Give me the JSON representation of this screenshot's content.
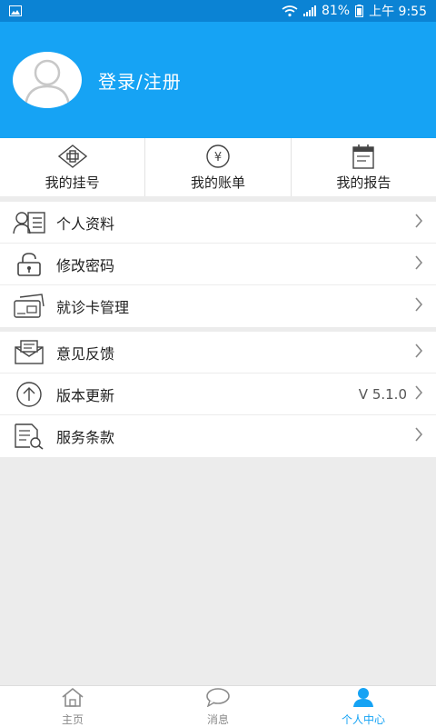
{
  "status_bar": {
    "battery": "81%",
    "time": "上午 9:55"
  },
  "header": {
    "login_text": "登录/注册"
  },
  "quick_actions": [
    {
      "label": "我的挂号",
      "icon": "registration-icon"
    },
    {
      "label": "我的账单",
      "icon": "bill-icon"
    },
    {
      "label": "我的报告",
      "icon": "report-icon"
    }
  ],
  "menu_group_1": [
    {
      "label": "个人资料",
      "icon": "profile-card-icon"
    },
    {
      "label": "修改密码",
      "icon": "lock-icon"
    },
    {
      "label": "就诊卡管理",
      "icon": "card-icon"
    }
  ],
  "menu_group_2": [
    {
      "label": "意见反馈",
      "icon": "feedback-mail-icon"
    },
    {
      "label": "版本更新",
      "icon": "update-arrow-icon",
      "value": "V 5.1.0"
    },
    {
      "label": "服务条款",
      "icon": "terms-document-icon"
    }
  ],
  "tabs": [
    {
      "label": "主页",
      "icon": "home-icon",
      "active": false
    },
    {
      "label": "消息",
      "icon": "message-icon",
      "active": false
    },
    {
      "label": "个人中心",
      "icon": "user-icon",
      "active": true
    }
  ],
  "colors": {
    "primary": "#16a3f4",
    "status_bar": "#0b83d4",
    "background": "#ececec"
  }
}
